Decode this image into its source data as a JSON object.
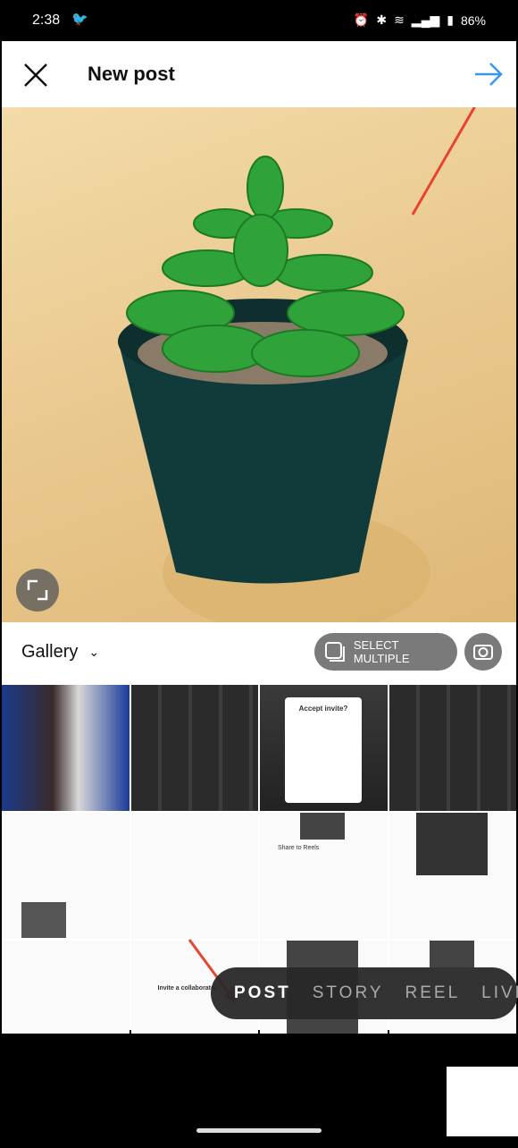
{
  "status_bar": {
    "time": "2:38",
    "notification_icon": "twitter-icon",
    "battery": "86%",
    "icons": [
      "alarm-icon",
      "bluetooth-icon",
      "volte-icon",
      "wifi-icon",
      "signal-icon",
      "battery-icon"
    ]
  },
  "header": {
    "title": "New post",
    "close_icon": "close-icon",
    "next_icon": "arrow-right-icon",
    "accent": "#3897f0"
  },
  "toolbar": {
    "gallery_label": "Gallery",
    "select_multiple_label": "SELECT MULTIPLE"
  },
  "thumbnails": {
    "accept_invite": "Accept invite?",
    "share_to_reels": "Share to Reels",
    "invite_collaborator": "Invite a collaborator"
  },
  "modes": {
    "items": [
      "POST",
      "STORY",
      "REEL",
      "LIVE"
    ],
    "selected": "POST"
  },
  "annotation_color": "#e8432f"
}
